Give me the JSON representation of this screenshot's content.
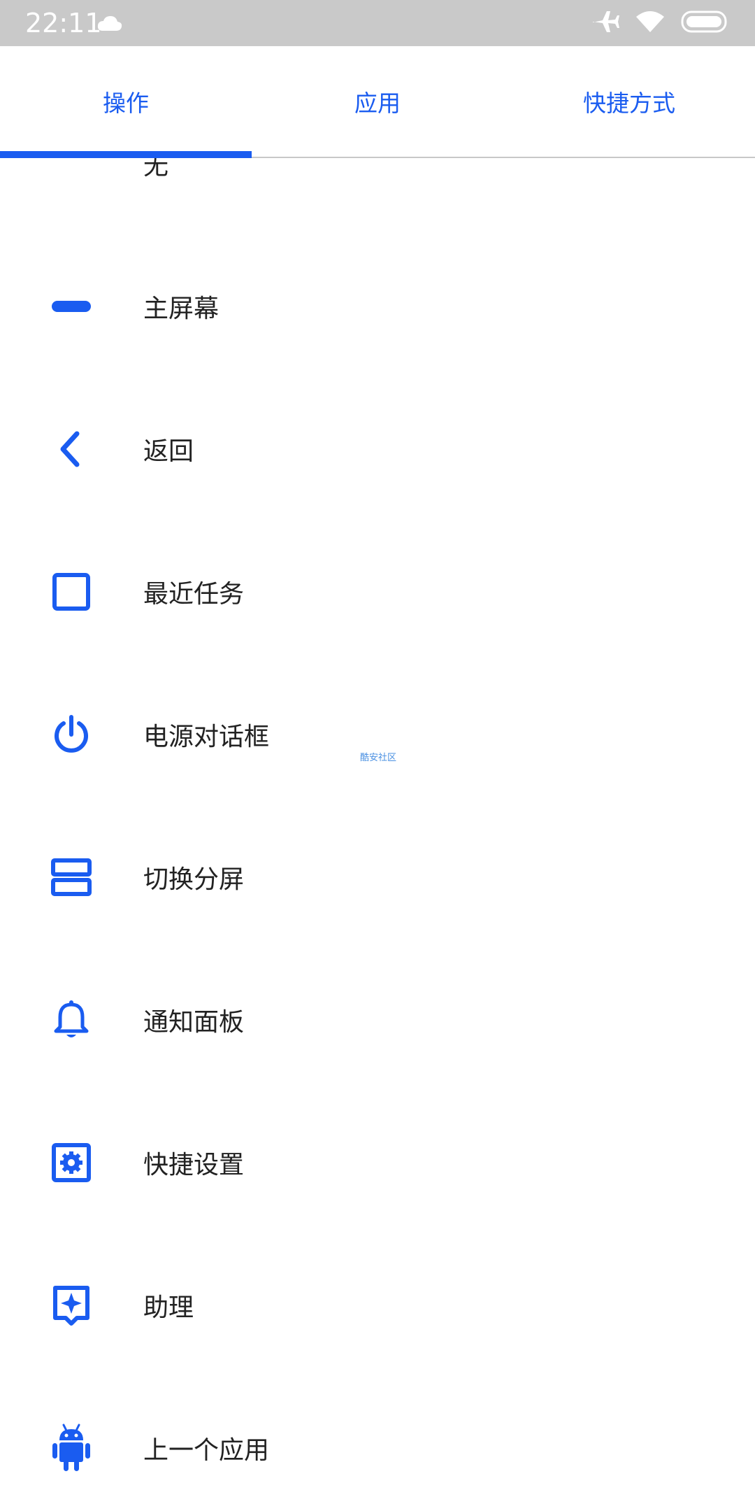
{
  "status_bar": {
    "time": "22:11"
  },
  "tabs": [
    {
      "label": "操作",
      "active": true
    },
    {
      "label": "应用",
      "active": false
    },
    {
      "label": "快捷方式",
      "active": false
    }
  ],
  "actions": [
    {
      "label": "无",
      "icon": "none"
    },
    {
      "label": "主屏幕",
      "icon": "home-pill-icon"
    },
    {
      "label": "返回",
      "icon": "back-chevron-icon"
    },
    {
      "label": "最近任务",
      "icon": "recents-square-icon"
    },
    {
      "label": "电源对话框",
      "icon": "power-icon"
    },
    {
      "label": "切换分屏",
      "icon": "split-screen-icon"
    },
    {
      "label": "通知面板",
      "icon": "bell-icon"
    },
    {
      "label": "快捷设置",
      "icon": "settings-gear-icon"
    },
    {
      "label": "助理",
      "icon": "assistant-icon"
    },
    {
      "label": "上一个应用",
      "icon": "android-icon"
    }
  ],
  "watermark": "酷安社区",
  "colors": {
    "accent": "#1a5cf0",
    "status_bar": "#c9c9c9",
    "text": "#222222"
  }
}
